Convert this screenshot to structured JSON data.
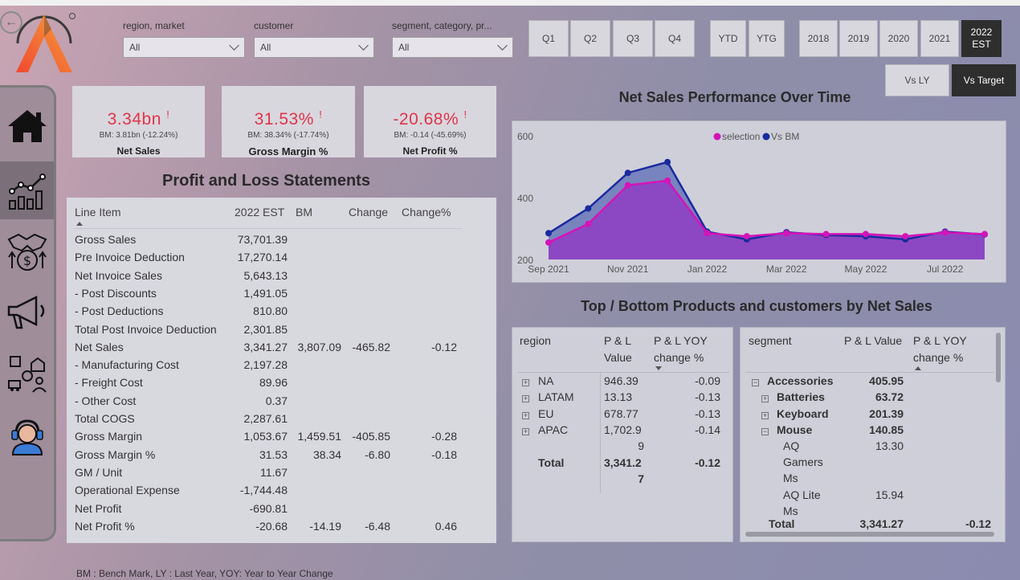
{
  "filters": [
    {
      "label": "region, market",
      "value": "All"
    },
    {
      "label": "customer",
      "value": "All"
    },
    {
      "label": "segment, category, pr...",
      "value": "All"
    }
  ],
  "quarters": [
    "Q1",
    "Q2",
    "Q3",
    "Q4"
  ],
  "periods": [
    "YTD",
    "YTG"
  ],
  "years": [
    "2018",
    "2019",
    "2020",
    "2021"
  ],
  "selected_year": {
    "line1": "2022",
    "line2": "EST"
  },
  "comparison": {
    "vs_ly": "Vs LY",
    "vs_target": "Vs Target"
  },
  "kpis": [
    {
      "value": "3.34bn",
      "flag": "!",
      "bm": "BM: 3.81bn (-12.24%)",
      "name": "Net Sales"
    },
    {
      "value": "31.53%",
      "flag": "!",
      "bm": "BM: 38.34% (-17.74%)",
      "name": "Gross Margin %"
    },
    {
      "value": "-20.68%",
      "flag": "!",
      "bm": "BM: -0.14 (-45.69%)",
      "name": "Net Profit %"
    }
  ],
  "pl": {
    "title": "Profit and Loss Statements",
    "headers": [
      "Line Item",
      "2022 EST",
      "BM",
      "Change",
      "Change%"
    ],
    "rows": [
      [
        "Gross Sales",
        "73,701.39",
        "",
        "",
        ""
      ],
      [
        "Pre Invoice Deduction",
        "17,270.14",
        "",
        "",
        ""
      ],
      [
        "Net Invoice Sales",
        "5,643.13",
        "",
        "",
        ""
      ],
      [
        "- Post Discounts",
        "1,491.05",
        "",
        "",
        ""
      ],
      [
        "- Post Deductions",
        "810.80",
        "",
        "",
        ""
      ],
      [
        "Total Post Invoice Deduction",
        "2,301.85",
        "",
        "",
        ""
      ],
      [
        "Net Sales",
        "3,341.27",
        "3,807.09",
        "-465.82",
        "-0.12"
      ],
      [
        "- Manufacturing Cost",
        "2,197.28",
        "",
        "",
        ""
      ],
      [
        "- Freight Cost",
        "89.96",
        "",
        "",
        ""
      ],
      [
        "- Other Cost",
        "0.37",
        "",
        "",
        ""
      ],
      [
        "Total COGS",
        "2,287.61",
        "",
        "",
        ""
      ],
      [
        "Gross Margin",
        "1,053.67",
        "1,459.51",
        "-405.85",
        "-0.28"
      ],
      [
        "Gross Margin %",
        "31.53",
        "38.34",
        "-6.80",
        "-0.18"
      ],
      [
        "GM / Unit",
        "11.67",
        "",
        "",
        ""
      ],
      [
        "Operational Expense",
        "-1,744.48",
        "",
        "",
        ""
      ],
      [
        "Net Profit",
        "-690.81",
        "",
        "",
        ""
      ],
      [
        "Net Profit %",
        "-20.68",
        "-14.19",
        "-6.48",
        "0.46"
      ]
    ]
  },
  "chart_title": "Net Sales Performance Over Time",
  "chart_data": {
    "type": "area",
    "x": [
      "Sep 2021",
      "Oct 2021",
      "Nov 2021",
      "Dec 2021",
      "Jan 2022",
      "Feb 2022",
      "Mar 2022",
      "Apr 2022",
      "May 2022",
      "Jun 2022",
      "Jul 2022",
      "Aug 2022"
    ],
    "x_tick_labels": [
      "Sep 2021",
      "Nov 2021",
      "Jan 2022",
      "Mar 2022",
      "May 2022",
      "Jul 2022"
    ],
    "y_ticks": [
      200,
      400,
      600
    ],
    "ylim": [
      200,
      600
    ],
    "legend_position": "top-center",
    "series": [
      {
        "name": "selection",
        "color": "#d414b8",
        "values": [
          255,
          315,
          440,
          455,
          285,
          275,
          285,
          282,
          282,
          275,
          287,
          282
        ]
      },
      {
        "name": "Vs BM",
        "color": "#1a2aa0",
        "values": [
          285,
          365,
          480,
          515,
          290,
          265,
          288,
          279,
          275,
          265,
          290,
          281
        ]
      }
    ]
  },
  "tb_title": "Top / Bottom Products and customers by  Net Sales",
  "region_table": {
    "headers": {
      "c1": "region",
      "c2a": "P & L",
      "c2b": "Value",
      "c3a": "P & L YOY",
      "c3b": "change %"
    },
    "rows": [
      {
        "name": "NA",
        "value": "946.39",
        "value2": "",
        "change": "-0.09"
      },
      {
        "name": "LATAM",
        "value": "13.13",
        "value2": "",
        "change": "-0.13"
      },
      {
        "name": "EU",
        "value": "678.77",
        "value2": "",
        "change": "-0.13"
      },
      {
        "name": "APAC",
        "value": "1,702.9",
        "value2": "9",
        "change": "-0.14"
      }
    ],
    "total": {
      "label": "Total",
      "value": "3,341.2",
      "value2": "7",
      "change": "-0.12"
    }
  },
  "segment_table": {
    "headers": {
      "c1": "segment",
      "c2": "P & L Value",
      "c3a": "P & L YOY",
      "c3b": "change %"
    },
    "rows": [
      {
        "name": "Accessories",
        "value": "405.95"
      },
      {
        "name": "Batteries",
        "value": "63.72"
      },
      {
        "name": "Keyboard",
        "value": "201.39"
      },
      {
        "name": "Mouse",
        "value": "140.85"
      },
      {
        "name": "AQ",
        "value": "13.30"
      },
      {
        "name": "Gamers",
        "value": ""
      },
      {
        "name": "Ms",
        "value": ""
      },
      {
        "name": "AQ Lite",
        "value": "15.94"
      },
      {
        "name": "Ms",
        "value": ""
      }
    ],
    "total": {
      "label": "Total",
      "value": "3,341.27",
      "change": "-0.12"
    }
  },
  "footnote": "BM : Bench Mark, LY : Last Year, YOY: Year to Year Change"
}
